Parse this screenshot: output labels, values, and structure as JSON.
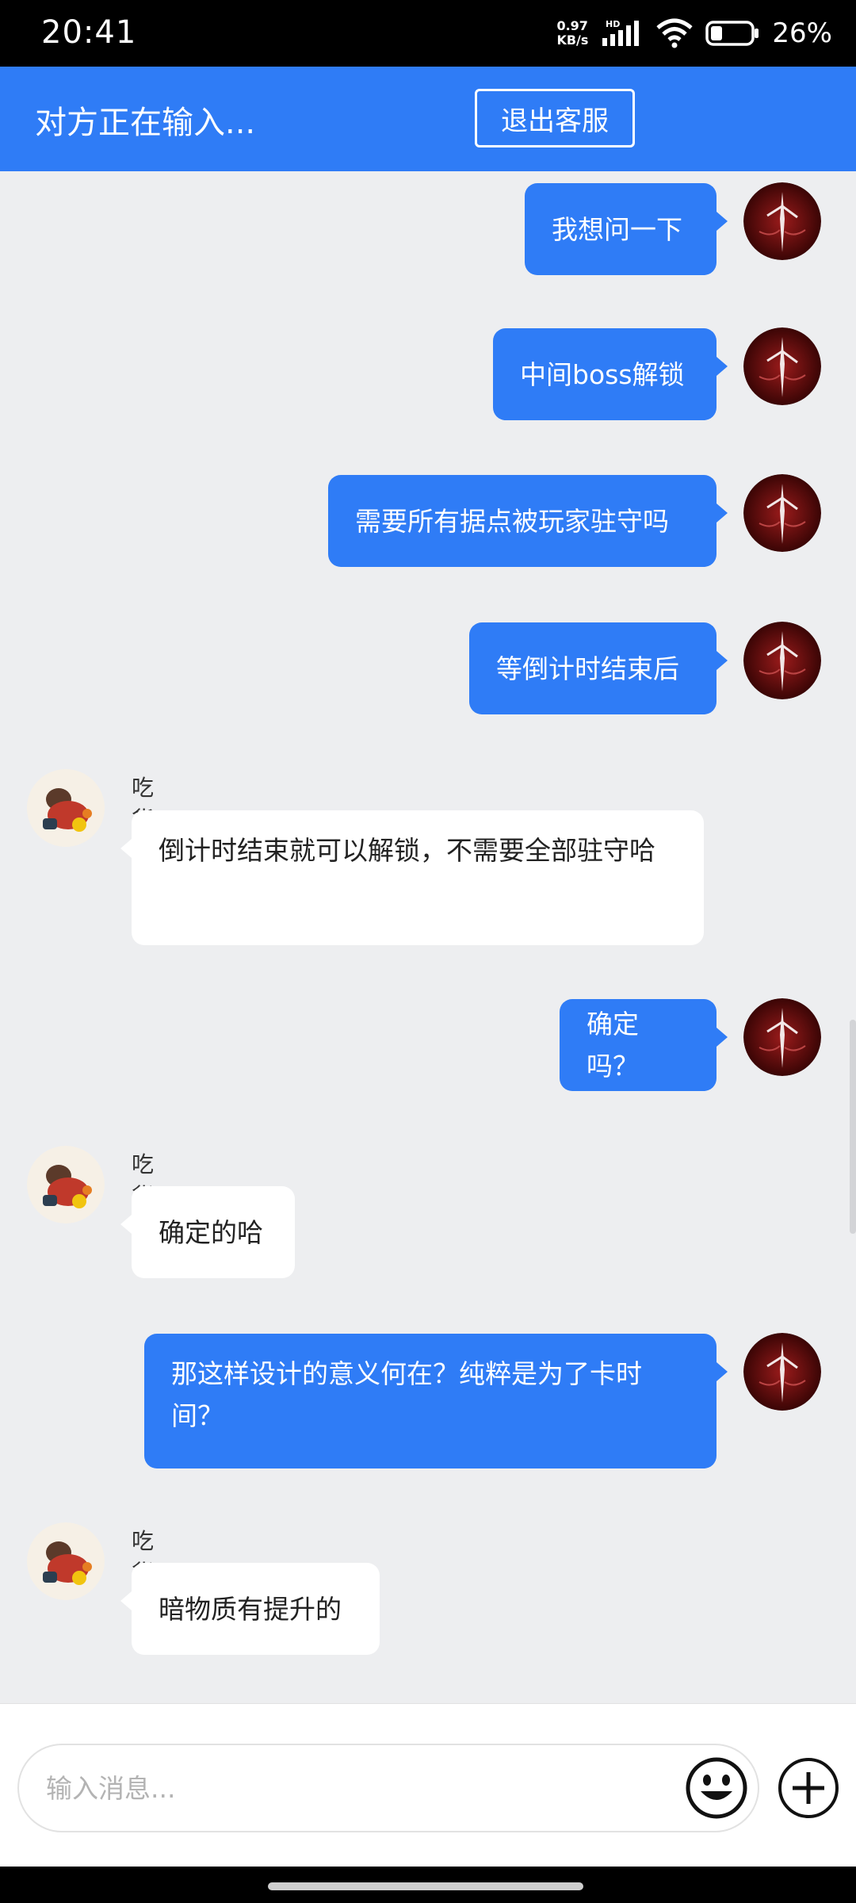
{
  "status_bar": {
    "time": "20:41",
    "speed_value": "0.97",
    "speed_unit": "KB/s",
    "network_badge": "HD",
    "battery_percent": "26%"
  },
  "header": {
    "title": "对方正在输入...",
    "exit_button": "退出客服"
  },
  "messages": [
    {
      "from": "me",
      "text": "我想问一下"
    },
    {
      "from": "me",
      "text": "中间boss解锁"
    },
    {
      "from": "me",
      "text": "需要所有据点被玩家驻守吗"
    },
    {
      "from": "me",
      "text": "等倒计时结束后"
    },
    {
      "from": "agent",
      "sender": "吃货酱",
      "text": "倒计时结束就可以解锁，不需要全部驻守哈"
    },
    {
      "from": "me",
      "text": "确定吗？"
    },
    {
      "from": "agent",
      "sender": "吃货酱",
      "text": "确定的哈"
    },
    {
      "from": "me",
      "text": "那这样设计的意义何在？纯粹是为了卡时间？"
    },
    {
      "from": "agent",
      "sender": "吃货酱",
      "text": "暗物质有提升的"
    }
  ],
  "input": {
    "placeholder": "输入消息..."
  },
  "icons": {
    "emoji": "emoji-icon",
    "plus": "plus-icon"
  },
  "colors": {
    "accent": "#2f7cf6",
    "chat_bg": "#edeef0"
  }
}
